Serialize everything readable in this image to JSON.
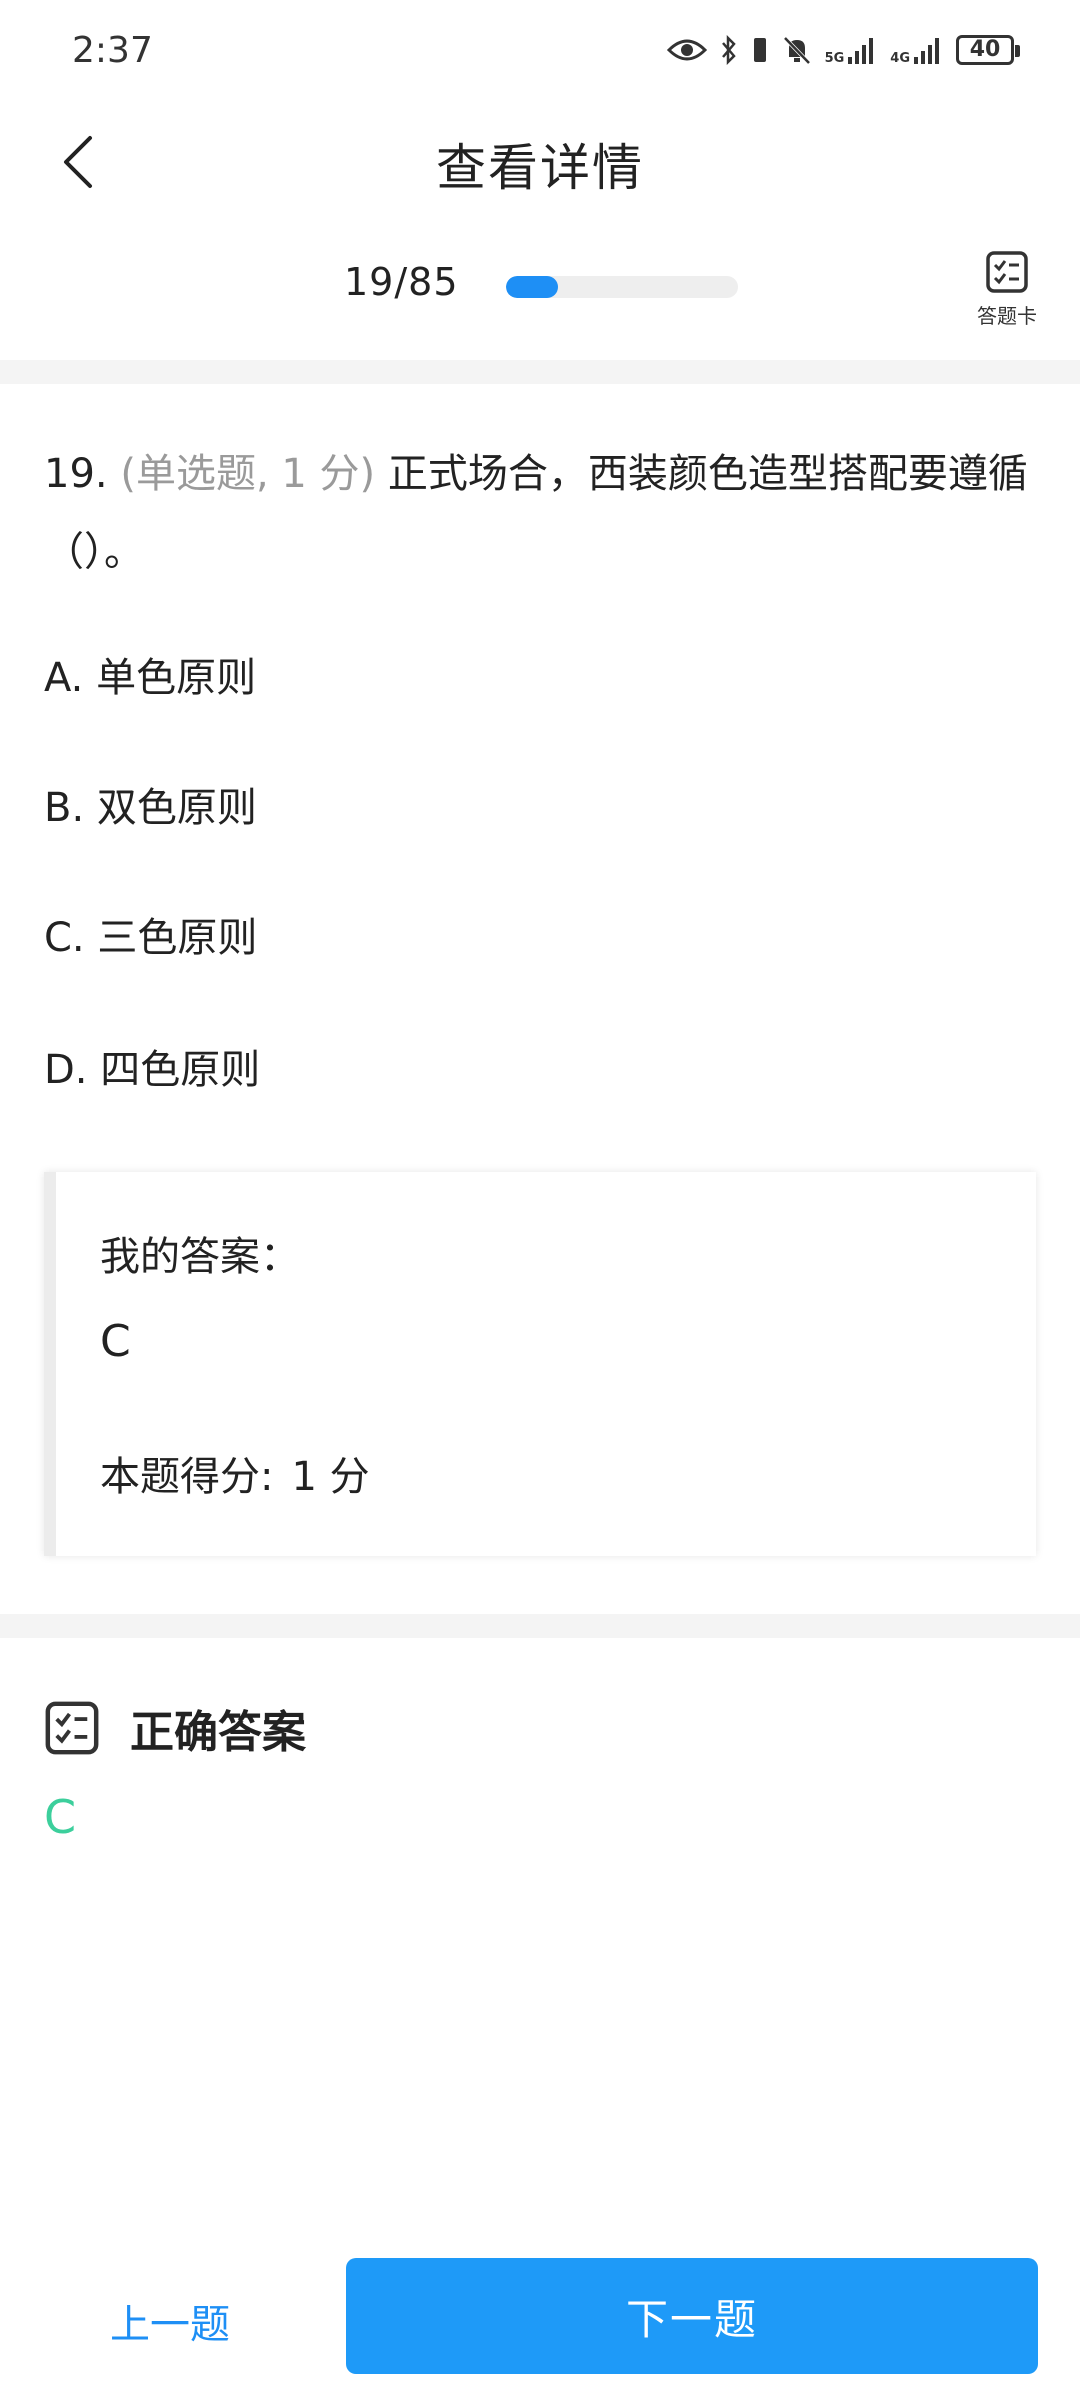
{
  "status_bar": {
    "time": "2:37",
    "signal_1_label": "5G",
    "signal_2_label": "4G",
    "battery": "40"
  },
  "nav": {
    "title": "查看详情"
  },
  "progress": {
    "text": "19/85",
    "current": 19,
    "total": 85,
    "fill_fraction": 0.224
  },
  "answer_card": {
    "label": "答题卡"
  },
  "question": {
    "number": "19.",
    "meta": "(单选题, 1 分)",
    "text": "正式场合，西装颜色造型搭配要遵循（）。"
  },
  "options": [
    {
      "label": "A. 单色原则"
    },
    {
      "label": "B. 双色原则"
    },
    {
      "label": "C. 三色原则"
    },
    {
      "label": "D. 四色原则"
    }
  ],
  "my_answer": {
    "label": "我的答案：",
    "value": "C",
    "score_label": "本题得分:",
    "score_value": "1 分"
  },
  "correct_answer": {
    "title": "正确答案",
    "value": "C"
  },
  "bottom": {
    "prev_label": "上一题",
    "next_label": "下一题"
  },
  "colors": {
    "accent": "#1e9af8",
    "correct": "#3ccf9c",
    "meta_gray": "#9a9a9a"
  }
}
